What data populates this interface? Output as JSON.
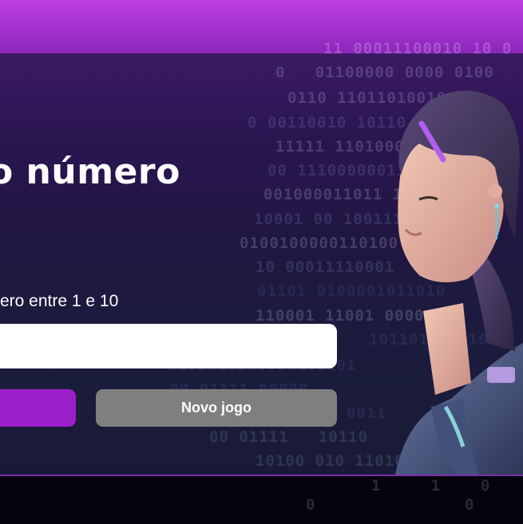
{
  "game": {
    "title": "o número",
    "prompt": "ero entre 1 e 10",
    "input_value": "",
    "guess_button_label": "",
    "new_game_button_label": "Novo jogo"
  },
  "colors": {
    "top_strip": "#b436db",
    "panel_top": "#3a1a63",
    "panel_bottom": "#191b36",
    "guess_button": "#9b1fc9",
    "new_game_button": "#7f7f7f",
    "bottom_strip": "#07030c"
  },
  "background": {
    "binary_lines": [
      "11 00011100010 10 0",
      "0   01100000 0000 0100",
      "0110 11011010010",
      "0 00110010 10110",
      "  11111 11010000011",
      "00 11100000011",
      "001000011011 1",
      "10001 00 1001110",
      "0100100000110100",
      "10 00011110001",
      "01101 0100001011010",
      "110001 11001 00001",
      "     101101000110",
      "1101111110001101101",
      "     00 01111 00000",
      "    000011001 0011",
      "00 01111   10110",
      "10100 010 11010",
      "1     1    0",
      "0               0"
    ],
    "portrait": "woman-with-headset-portrait"
  }
}
